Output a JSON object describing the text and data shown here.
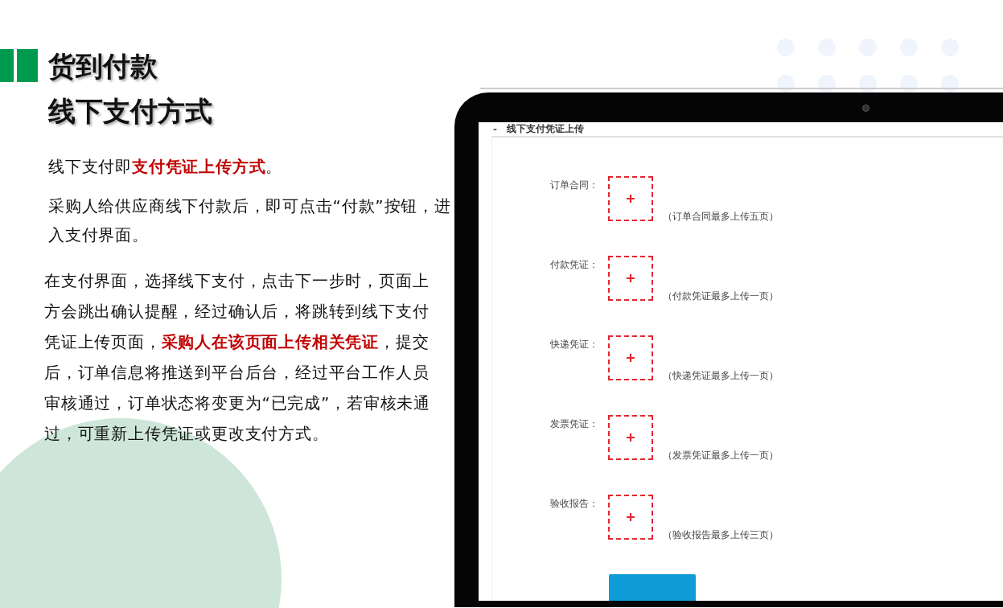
{
  "slide": {
    "title_lines": [
      "货到付款",
      "线下支付方式"
    ],
    "paragraphs": [
      "线下支付即**支付凭证上传方式**。",
      "采购人给供应商线下付款后，即可点击“付款”按钮，进入支付界面。",
      "在支付界面，选择线下支付，点击下一步时，页面上方会跳出确认提醒，经过确认后，将跳转到线下支付凭证上传页面，**采购人在该页面上传相关凭证**，提交后，订单信息将推送到平台后台，经过平台工作人员审核通过，订单状态将变更为“已完成”，若审核未通过，可重新上传凭证或更改支付方式。"
    ]
  },
  "screen": {
    "collapse_glyph": "-",
    "section_title": "线下支付凭证上传",
    "uploads": [
      {
        "label": "订单合同：",
        "hint": "（订单合同最多上传五页）"
      },
      {
        "label": "付款凭证：",
        "hint": "（付款凭证最多上传一页）"
      },
      {
        "label": "快递凭证：",
        "hint": "（快递凭证最多上传一页）"
      },
      {
        "label": "发票凭证：",
        "hint": "（发票凭证最多上传一页）"
      },
      {
        "label": "验收报告：",
        "hint": "（验收报告最多上传三页）"
      }
    ]
  }
}
